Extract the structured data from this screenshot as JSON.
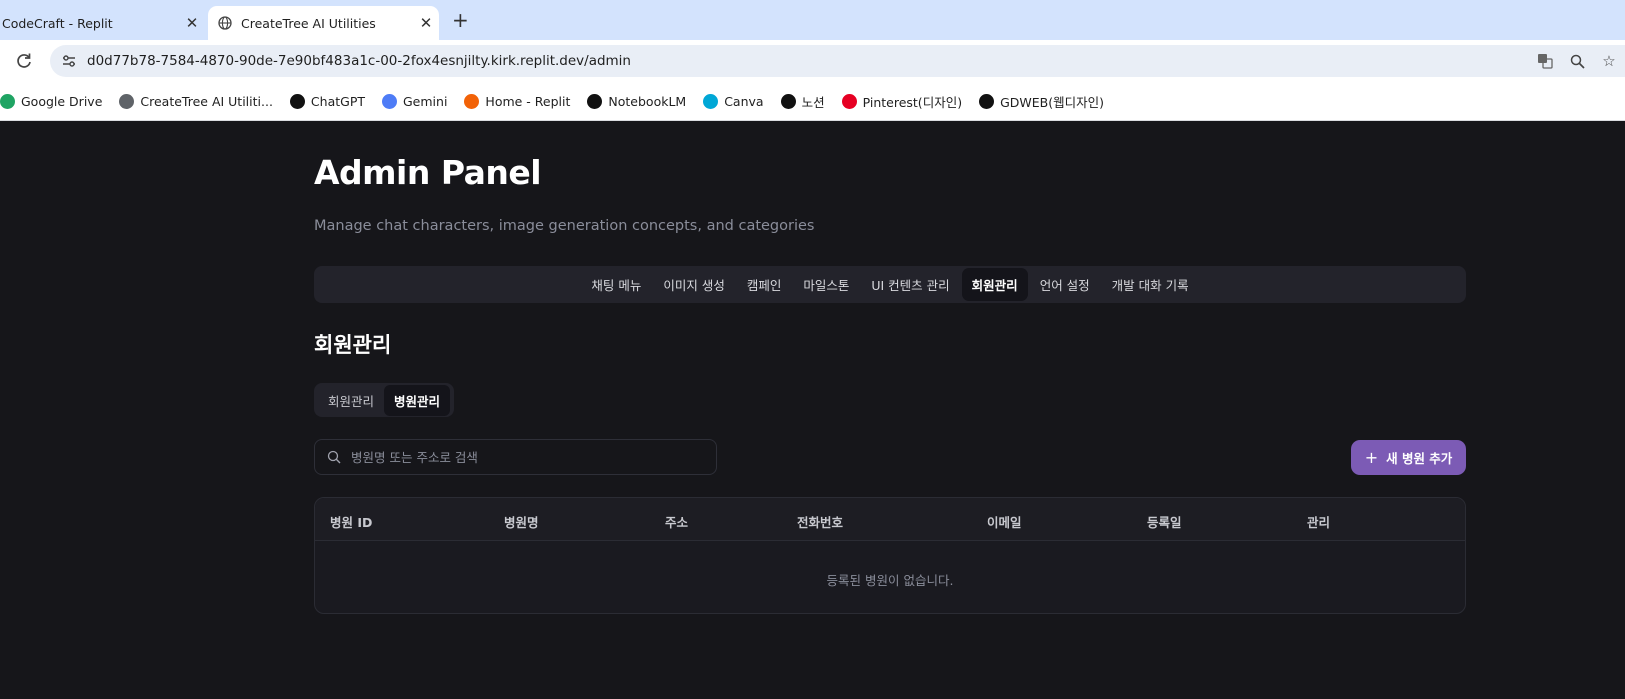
{
  "browser": {
    "tabs": [
      {
        "title": "CodeCraft - Replit",
        "active": false
      },
      {
        "title": "CreateTree AI Utilities",
        "active": true
      }
    ],
    "url": "d0d77b78-7584-4870-90de-7e90bf483a1c-00-2fox4esnjilty.kirk.replit.dev/admin",
    "bookmarks": [
      {
        "label": "Google Drive",
        "icon": "google-drive-icon",
        "color": "#1fa463"
      },
      {
        "label": "CreateTree AI Utiliti...",
        "icon": "globe-icon",
        "color": "#5f6368"
      },
      {
        "label": "ChatGPT",
        "icon": "chatgpt-icon",
        "color": "#111111"
      },
      {
        "label": "Gemini",
        "icon": "gemini-icon",
        "color": "#4e7cf6"
      },
      {
        "label": "Home - Replit",
        "icon": "replit-icon",
        "color": "#f26207"
      },
      {
        "label": "NotebookLM",
        "icon": "notebooklm-icon",
        "color": "#111111"
      },
      {
        "label": "Canva",
        "icon": "canva-icon",
        "color": "#00a7d6"
      },
      {
        "label": "노션",
        "icon": "notion-icon",
        "color": "#111111"
      },
      {
        "label": "Pinterest(디자인)",
        "icon": "pinterest-icon",
        "color": "#e60023"
      },
      {
        "label": "GDWEB(웹디자인)",
        "icon": "gdweb-icon",
        "color": "#111111"
      }
    ]
  },
  "page": {
    "title": "Admin Panel",
    "subtitle": "Manage chat characters, image generation concepts, and categories",
    "nav": [
      {
        "label": "채팅 메뉴",
        "active": false
      },
      {
        "label": "이미지 생성",
        "active": false
      },
      {
        "label": "캠페인",
        "active": false
      },
      {
        "label": "마일스톤",
        "active": false
      },
      {
        "label": "UI 컨텐츠 관리",
        "active": false
      },
      {
        "label": "회원관리",
        "active": true
      },
      {
        "label": "언어 설정",
        "active": false
      },
      {
        "label": "개발 대화 기록",
        "active": false
      }
    ],
    "section_title": "회원관리",
    "subtabs": [
      {
        "label": "회원관리",
        "active": false
      },
      {
        "label": "병원관리",
        "active": true
      }
    ],
    "search": {
      "placeholder": "병원명 또는 주소로 검색",
      "value": ""
    },
    "add_button": "새 병원 추가",
    "table": {
      "columns": [
        "병원 ID",
        "병원명",
        "주소",
        "전화번호",
        "이메일",
        "등록일",
        "관리"
      ],
      "rows": [],
      "empty_message": "등록된 병원이 없습니다."
    }
  },
  "colors": {
    "accent": "#7c5bb5",
    "background": "#16161a",
    "panel": "#23232b"
  }
}
